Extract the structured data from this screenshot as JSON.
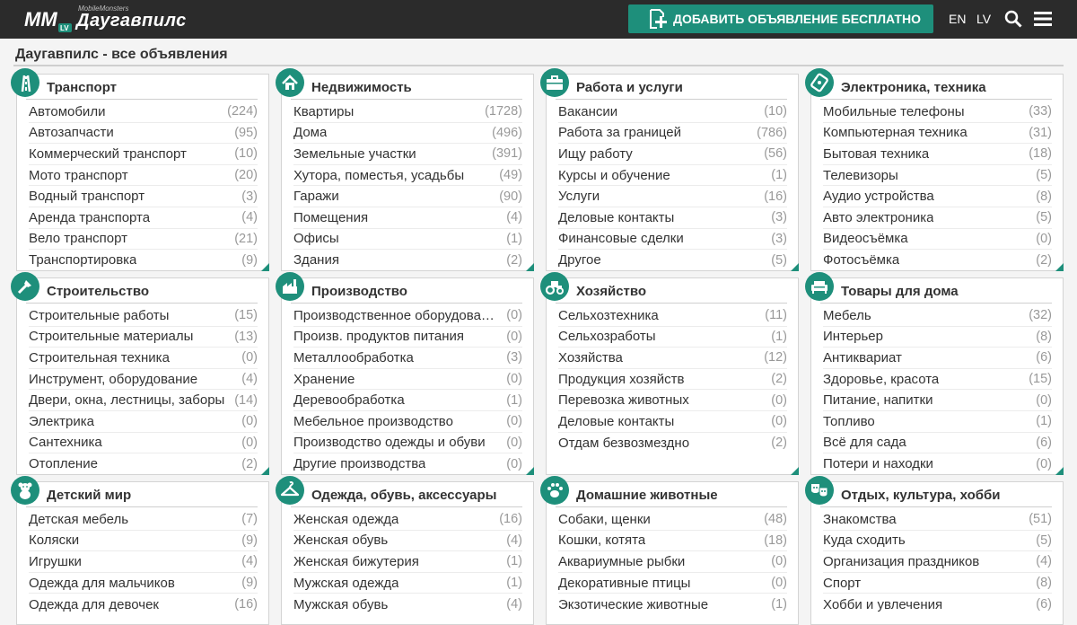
{
  "header": {
    "logo_small": "MobileMonsters",
    "logo_city": "Даугавпилс",
    "add_button": "ДОБАВИТЬ ОБЪЯВЛЕНИЕ БЕСПЛАТНО",
    "lang_en": "EN",
    "lang_lv": "LV",
    "accent": "#1e8f7b"
  },
  "page": {
    "city": "Даугавпилс",
    "rest": " - все объявления"
  },
  "categories": [
    {
      "title": "Транспорт",
      "icon": "road-icon",
      "items": [
        {
          "name": "Автомобили",
          "count": "(224)"
        },
        {
          "name": "Автозапчасти",
          "count": "(95)"
        },
        {
          "name": "Коммерческий транспорт",
          "count": "(10)"
        },
        {
          "name": "Мото транспорт",
          "count": "(20)"
        },
        {
          "name": "Водный транспорт",
          "count": "(3)"
        },
        {
          "name": "Аренда транспорта",
          "count": "(4)"
        },
        {
          "name": "Вело транспорт",
          "count": "(21)"
        },
        {
          "name": "Транспортировка",
          "count": "(9)"
        }
      ]
    },
    {
      "title": "Недвижимость",
      "icon": "house-icon",
      "items": [
        {
          "name": "Квартиры",
          "count": "(1728)"
        },
        {
          "name": "Дома",
          "count": "(496)"
        },
        {
          "name": "Земельные участки",
          "count": "(391)"
        },
        {
          "name": "Хутора, поместья, усадьбы",
          "count": "(49)"
        },
        {
          "name": "Гаражи",
          "count": "(90)"
        },
        {
          "name": "Помещения",
          "count": "(4)"
        },
        {
          "name": "Офисы",
          "count": "(1)"
        },
        {
          "name": "Здания",
          "count": "(2)"
        }
      ]
    },
    {
      "title": "Работа и услуги",
      "icon": "briefcase-icon",
      "items": [
        {
          "name": "Вакансии",
          "count": "(10)"
        },
        {
          "name": "Работа за границей",
          "count": "(786)"
        },
        {
          "name": "Ищу работу",
          "count": "(56)"
        },
        {
          "name": "Курсы и обучение",
          "count": "(1)"
        },
        {
          "name": "Услуги",
          "count": "(16)"
        },
        {
          "name": "Деловые контакты",
          "count": "(3)"
        },
        {
          "name": "Финансовые сделки",
          "count": "(3)"
        },
        {
          "name": "Другое",
          "count": "(5)"
        }
      ]
    },
    {
      "title": "Электроника, техника",
      "icon": "electronics-icon",
      "items": [
        {
          "name": "Мобильные телефоны",
          "count": "(33)"
        },
        {
          "name": "Компьютерная техника",
          "count": "(31)"
        },
        {
          "name": "Бытовая техника",
          "count": "(18)"
        },
        {
          "name": "Телевизоры",
          "count": "(5)"
        },
        {
          "name": "Аудио устройства",
          "count": "(8)"
        },
        {
          "name": "Авто электроника",
          "count": "(5)"
        },
        {
          "name": "Видеосъёмка",
          "count": "(0)"
        },
        {
          "name": "Фотосъёмка",
          "count": "(2)"
        }
      ]
    },
    {
      "title": "Строительство",
      "icon": "trowel-icon",
      "items": [
        {
          "name": "Строительные работы",
          "count": "(15)"
        },
        {
          "name": "Строительные материалы",
          "count": "(13)"
        },
        {
          "name": "Строительная техника",
          "count": "(0)"
        },
        {
          "name": "Инструмент, оборудование",
          "count": "(4)"
        },
        {
          "name": "Двери, окна, лестницы, заборы",
          "count": "(14)"
        },
        {
          "name": "Электрика",
          "count": "(0)"
        },
        {
          "name": "Сантехника",
          "count": "(0)"
        },
        {
          "name": "Отопление",
          "count": "(2)"
        }
      ]
    },
    {
      "title": "Производство",
      "icon": "factory-icon",
      "items": [
        {
          "name": "Производственное оборудован…",
          "count": "(0)"
        },
        {
          "name": "Произв. продуктов питания",
          "count": "(0)"
        },
        {
          "name": "Металлообработка",
          "count": "(3)"
        },
        {
          "name": "Хранение",
          "count": "(0)"
        },
        {
          "name": "Деревообработка",
          "count": "(1)"
        },
        {
          "name": "Мебельное производство",
          "count": "(0)"
        },
        {
          "name": "Производство одежды и обуви",
          "count": "(0)"
        },
        {
          "name": "Другие производства",
          "count": "(0)"
        }
      ]
    },
    {
      "title": "Хозяйство",
      "icon": "tractor-icon",
      "items": [
        {
          "name": "Сельхозтехника",
          "count": "(11)"
        },
        {
          "name": "Сельхозработы",
          "count": "(1)"
        },
        {
          "name": "Хозяйства",
          "count": "(12)"
        },
        {
          "name": "Продукция хозяйств",
          "count": "(2)"
        },
        {
          "name": "Перевозка животных",
          "count": "(0)"
        },
        {
          "name": "Деловые контакты",
          "count": "(0)"
        },
        {
          "name": "Отдам безвозмездно",
          "count": "(2)"
        }
      ]
    },
    {
      "title": "Товары для дома",
      "icon": "sofa-icon",
      "items": [
        {
          "name": "Мебель",
          "count": "(32)"
        },
        {
          "name": "Интерьер",
          "count": "(8)"
        },
        {
          "name": "Антиквариат",
          "count": "(6)"
        },
        {
          "name": "Здоровье, красота",
          "count": "(15)"
        },
        {
          "name": "Питание, напитки",
          "count": "(0)"
        },
        {
          "name": "Топливо",
          "count": "(1)"
        },
        {
          "name": "Всё для сада",
          "count": "(6)"
        },
        {
          "name": "Потери и находки",
          "count": "(0)"
        }
      ]
    },
    {
      "title": "Детский мир",
      "icon": "teddy-bear-icon",
      "items": [
        {
          "name": "Детская мебель",
          "count": "(7)"
        },
        {
          "name": "Коляски",
          "count": "(9)"
        },
        {
          "name": "Игрушки",
          "count": "(4)"
        },
        {
          "name": "Одежда для мальчиков",
          "count": "(9)"
        },
        {
          "name": "Одежда для девочек",
          "count": "(16)"
        }
      ]
    },
    {
      "title": "Одежда, обувь, аксессуары",
      "icon": "hanger-icon",
      "items": [
        {
          "name": "Женская одежда",
          "count": "(16)"
        },
        {
          "name": "Женская обувь",
          "count": "(4)"
        },
        {
          "name": "Женская бижутерия",
          "count": "(1)"
        },
        {
          "name": "Мужская одежда",
          "count": "(1)"
        },
        {
          "name": "Мужская обувь",
          "count": "(4)"
        }
      ]
    },
    {
      "title": "Домашние животные",
      "icon": "paw-icon",
      "items": [
        {
          "name": "Собаки, щенки",
          "count": "(48)"
        },
        {
          "name": "Кошки, котята",
          "count": "(18)"
        },
        {
          "name": "Аквариумные рыбки",
          "count": "(0)"
        },
        {
          "name": "Декоративные птицы",
          "count": "(0)"
        },
        {
          "name": "Экзотические животные",
          "count": "(1)"
        }
      ]
    },
    {
      "title": "Отдых, культура, хобби",
      "icon": "masks-icon",
      "items": [
        {
          "name": "Знакомства",
          "count": "(51)"
        },
        {
          "name": "Куда сходить",
          "count": "(5)"
        },
        {
          "name": "Организация праздников",
          "count": "(4)"
        },
        {
          "name": "Спорт",
          "count": "(8)"
        },
        {
          "name": "Хобби и увлечения",
          "count": "(6)"
        }
      ]
    }
  ]
}
